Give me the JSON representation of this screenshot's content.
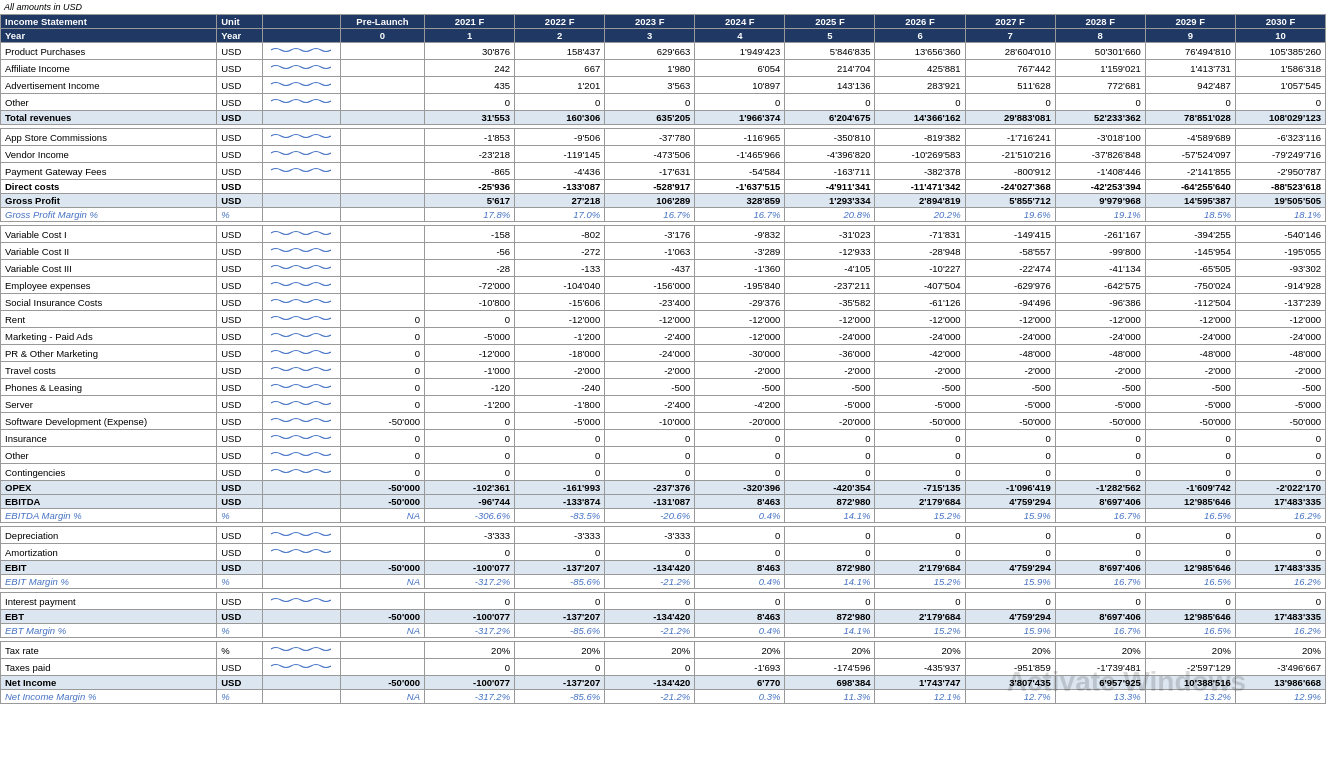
{
  "note": "All amounts in USD",
  "headers": {
    "col0": "Income Statement",
    "col1": "Unit",
    "col2": "",
    "col3": "Pre-Launch",
    "col4": "2021 F",
    "col5": "2022 F",
    "col6": "2023 F",
    "col7": "2024 F",
    "col8": "2025 F",
    "col9": "2026 F",
    "col10": "2027 F",
    "col11": "2028 F",
    "col12": "2029 F",
    "col13": "2030 F",
    "row_year": "Year",
    "year_unit": "Year",
    "years": [
      "0",
      "1",
      "2",
      "3",
      "4",
      "5",
      "6",
      "7",
      "8",
      "9",
      "10"
    ]
  },
  "rows": [
    {
      "label": "Product Purchases",
      "unit": "USD",
      "spark": true,
      "pre": "",
      "y1": "30'876",
      "y2": "158'437",
      "y3": "629'663",
      "y4": "1'949'423",
      "y5": "5'846'835",
      "y6": "13'656'360",
      "y7": "28'604'010",
      "y8": "50'301'660",
      "y9": "76'494'810",
      "y10": "105'385'260"
    },
    {
      "label": "Affiliate Income",
      "unit": "USD",
      "spark": true,
      "pre": "",
      "y1": "242",
      "y2": "667",
      "y3": "1'980",
      "y4": "6'054",
      "y5": "214'704",
      "y6": "425'881",
      "y7": "767'442",
      "y8": "1'159'021",
      "y9": "1'413'731",
      "y10": "1'586'318"
    },
    {
      "label": "Advertisement Income",
      "unit": "USD",
      "spark": true,
      "pre": "",
      "y1": "435",
      "y2": "1'201",
      "y3": "3'563",
      "y4": "10'897",
      "y5": "143'136",
      "y6": "283'921",
      "y7": "511'628",
      "y8": "772'681",
      "y9": "942'487",
      "y10": "1'057'545"
    },
    {
      "label": "Other",
      "unit": "USD",
      "spark": true,
      "pre": "",
      "y1": "0",
      "y2": "0",
      "y3": "0",
      "y4": "0",
      "y5": "0",
      "y6": "0",
      "y7": "0",
      "y8": "0",
      "y9": "0",
      "y10": "0"
    },
    {
      "label": "Total revenues",
      "unit": "USD",
      "spark": false,
      "pre": "",
      "y1": "31'553",
      "y2": "160'306",
      "y3": "635'205",
      "y4": "1'966'374",
      "y5": "6'204'675",
      "y6": "14'366'162",
      "y7": "29'883'081",
      "y8": "52'233'362",
      "y9": "78'851'028",
      "y10": "108'029'123",
      "type": "total"
    },
    {
      "label": "",
      "unit": "",
      "spark": false,
      "pre": "",
      "y1": "",
      "y2": "",
      "y3": "",
      "y4": "",
      "y5": "",
      "y6": "",
      "y7": "",
      "y8": "",
      "y9": "",
      "y10": "",
      "type": "spacer"
    },
    {
      "label": "App Store Commissions",
      "unit": "USD",
      "spark": true,
      "pre": "",
      "y1": "-1'853",
      "y2": "-9'506",
      "y3": "-37'780",
      "y4": "-116'965",
      "y5": "-350'810",
      "y6": "-819'382",
      "y7": "-1'716'241",
      "y8": "-3'018'100",
      "y9": "-4'589'689",
      "y10": "-6'323'116"
    },
    {
      "label": "Vendor Income",
      "unit": "USD",
      "spark": true,
      "pre": "",
      "y1": "-23'218",
      "y2": "-119'145",
      "y3": "-473'506",
      "y4": "-1'465'966",
      "y5": "-4'396'820",
      "y6": "-10'269'583",
      "y7": "-21'510'216",
      "y8": "-37'826'848",
      "y9": "-57'524'097",
      "y10": "-79'249'716"
    },
    {
      "label": "Payment Gateway Fees",
      "unit": "USD",
      "spark": true,
      "pre": "",
      "y1": "-865",
      "y2": "-4'436",
      "y3": "-17'631",
      "y4": "-54'584",
      "y5": "-163'711",
      "y6": "-382'378",
      "y7": "-800'912",
      "y8": "-1'408'446",
      "y9": "-2'141'855",
      "y10": "-2'950'787"
    },
    {
      "label": "Direct costs",
      "unit": "USD",
      "spark": false,
      "pre": "",
      "y1": "-25'936",
      "y2": "-133'087",
      "y3": "-528'917",
      "y4": "-1'637'515",
      "y5": "-4'911'341",
      "y6": "-11'471'342",
      "y7": "-24'027'368",
      "y8": "-42'253'394",
      "y9": "-64'255'640",
      "y10": "-88'523'618",
      "type": "direct"
    },
    {
      "label": "Gross Profit",
      "unit": "USD",
      "spark": false,
      "pre": "",
      "y1": "5'617",
      "y2": "27'218",
      "y3": "106'289",
      "y4": "328'859",
      "y5": "1'293'334",
      "y6": "2'894'819",
      "y7": "5'855'712",
      "y8": "9'979'968",
      "y9": "14'595'387",
      "y10": "19'505'505",
      "type": "gross-profit"
    },
    {
      "label": "Gross Profit Margin %",
      "unit": "%",
      "spark": false,
      "pre": "",
      "y1": "17.8%",
      "y2": "17.0%",
      "y3": "16.7%",
      "y4": "16.7%",
      "y5": "20.8%",
      "y6": "20.2%",
      "y7": "19.6%",
      "y8": "19.1%",
      "y9": "18.5%",
      "y10": "18.1%",
      "type": "margin"
    },
    {
      "label": "",
      "unit": "",
      "spark": false,
      "pre": "",
      "y1": "",
      "y2": "",
      "y3": "",
      "y4": "",
      "y5": "",
      "y6": "",
      "y7": "",
      "y8": "",
      "y9": "",
      "y10": "",
      "type": "spacer"
    },
    {
      "label": "Variable Cost I",
      "unit": "USD",
      "spark": true,
      "pre": "",
      "y1": "-158",
      "y2": "-802",
      "y3": "-3'176",
      "y4": "-9'832",
      "y5": "-31'023",
      "y6": "-71'831",
      "y7": "-149'415",
      "y8": "-261'167",
      "y9": "-394'255",
      "y10": "-540'146"
    },
    {
      "label": "Variable Cost II",
      "unit": "USD",
      "spark": true,
      "pre": "",
      "y1": "-56",
      "y2": "-272",
      "y3": "-1'063",
      "y4": "-3'289",
      "y5": "-12'933",
      "y6": "-28'948",
      "y7": "-58'557",
      "y8": "-99'800",
      "y9": "-145'954",
      "y10": "-195'055"
    },
    {
      "label": "Variable Cost III",
      "unit": "USD",
      "spark": true,
      "pre": "",
      "y1": "-28",
      "y2": "-133",
      "y3": "-437",
      "y4": "-1'360",
      "y5": "-4'105",
      "y6": "-10'227",
      "y7": "-22'474",
      "y8": "-41'134",
      "y9": "-65'505",
      "y10": "-93'302"
    },
    {
      "label": "Employee expenses",
      "unit": "USD",
      "spark": true,
      "pre": "",
      "y1": "-72'000",
      "y2": "-104'040",
      "y3": "-156'000",
      "y4": "-195'840",
      "y5": "-237'211",
      "y6": "-407'504",
      "y7": "-629'976",
      "y8": "-642'575",
      "y9": "-750'024",
      "y10": "-914'928"
    },
    {
      "label": "Social Insurance Costs",
      "unit": "USD",
      "spark": true,
      "pre": "",
      "y1": "-10'800",
      "y2": "-15'606",
      "y3": "-23'400",
      "y4": "-29'376",
      "y5": "-35'582",
      "y6": "-61'126",
      "y7": "-94'496",
      "y8": "-96'386",
      "y9": "-112'504",
      "y10": "-137'239"
    },
    {
      "label": "Rent",
      "unit": "USD",
      "spark": true,
      "pre": "0",
      "y1": "0",
      "y2": "-12'000",
      "y3": "-12'000",
      "y4": "-12'000",
      "y5": "-12'000",
      "y6": "-12'000",
      "y7": "-12'000",
      "y8": "-12'000",
      "y9": "-12'000",
      "y10": "-12'000"
    },
    {
      "label": "Marketing - Paid Ads",
      "unit": "USD",
      "spark": true,
      "pre": "0",
      "y1": "-5'000",
      "y2": "-1'200",
      "y3": "-2'400",
      "y4": "-12'000",
      "y5": "-24'000",
      "y6": "-24'000",
      "y7": "-24'000",
      "y8": "-24'000",
      "y9": "-24'000",
      "y10": "-24'000"
    },
    {
      "label": "PR & Other Marketing",
      "unit": "USD",
      "spark": true,
      "pre": "0",
      "y1": "-12'000",
      "y2": "-18'000",
      "y3": "-24'000",
      "y4": "-30'000",
      "y5": "-36'000",
      "y6": "-42'000",
      "y7": "-48'000",
      "y8": "-48'000",
      "y9": "-48'000",
      "y10": "-48'000"
    },
    {
      "label": "Travel costs",
      "unit": "USD",
      "spark": true,
      "pre": "0",
      "y1": "-1'000",
      "y2": "-2'000",
      "y3": "-2'000",
      "y4": "-2'000",
      "y5": "-2'000",
      "y6": "-2'000",
      "y7": "-2'000",
      "y8": "-2'000",
      "y9": "-2'000",
      "y10": "-2'000"
    },
    {
      "label": "Phones & Leasing",
      "unit": "USD",
      "spark": true,
      "pre": "0",
      "y1": "-120",
      "y2": "-240",
      "y3": "-500",
      "y4": "-500",
      "y5": "-500",
      "y6": "-500",
      "y7": "-500",
      "y8": "-500",
      "y9": "-500",
      "y10": "-500"
    },
    {
      "label": "Server",
      "unit": "USD",
      "spark": true,
      "pre": "0",
      "y1": "-1'200",
      "y2": "-1'800",
      "y3": "-2'400",
      "y4": "-4'200",
      "y5": "-5'000",
      "y6": "-5'000",
      "y7": "-5'000",
      "y8": "-5'000",
      "y9": "-5'000",
      "y10": "-5'000"
    },
    {
      "label": "Software Development (Expense)",
      "unit": "USD",
      "spark": true,
      "pre": "-50'000",
      "y1": "0",
      "y2": "-5'000",
      "y3": "-10'000",
      "y4": "-20'000",
      "y5": "-20'000",
      "y6": "-50'000",
      "y7": "-50'000",
      "y8": "-50'000",
      "y9": "-50'000",
      "y10": "-50'000"
    },
    {
      "label": "Insurance",
      "unit": "USD",
      "spark": true,
      "pre": "0",
      "y1": "0",
      "y2": "0",
      "y3": "0",
      "y4": "0",
      "y5": "0",
      "y6": "0",
      "y7": "0",
      "y8": "0",
      "y9": "0",
      "y10": "0"
    },
    {
      "label": "Other",
      "unit": "USD",
      "spark": true,
      "pre": "0",
      "y1": "0",
      "y2": "0",
      "y3": "0",
      "y4": "0",
      "y5": "0",
      "y6": "0",
      "y7": "0",
      "y8": "0",
      "y9": "0",
      "y10": "0"
    },
    {
      "label": "Contingencies",
      "unit": "USD",
      "spark": true,
      "pre": "0",
      "y1": "0",
      "y2": "0",
      "y3": "0",
      "y4": "0",
      "y5": "0",
      "y6": "0",
      "y7": "0",
      "y8": "0",
      "y9": "0",
      "y10": "0"
    },
    {
      "label": "OPEX",
      "unit": "USD",
      "spark": false,
      "pre": "-50'000",
      "y1": "-102'361",
      "y2": "-161'993",
      "y3": "-237'376",
      "y4": "-320'396",
      "y5": "-420'354",
      "y6": "-715'135",
      "y7": "-1'096'419",
      "y8": "-1'282'562",
      "y9": "-1'609'742",
      "y10": "-2'022'170",
      "type": "opex"
    },
    {
      "label": "EBITDA",
      "unit": "USD",
      "spark": false,
      "pre": "-50'000",
      "y1": "-96'744",
      "y2": "-133'874",
      "y3": "-131'087",
      "y4": "8'463",
      "y5": "872'980",
      "y6": "2'179'684",
      "y7": "4'759'294",
      "y8": "8'697'406",
      "y9": "12'985'646",
      "y10": "17'483'335",
      "type": "ebitda"
    },
    {
      "label": "EBITDA Margin %",
      "unit": "%",
      "spark": false,
      "pre": "",
      "y1": "-306.6%",
      "y2": "-83.5%",
      "y3": "-20.6%",
      "y4": "0.4%",
      "y5": "14.1%",
      "y6": "15.2%",
      "y7": "15.9%",
      "y8": "16.7%",
      "y9": "16.5%",
      "y10": "16.2%",
      "pre_special": "NA",
      "type": "margin"
    },
    {
      "label": "",
      "unit": "",
      "spark": false,
      "pre": "",
      "y1": "",
      "y2": "",
      "y3": "",
      "y4": "",
      "y5": "",
      "y6": "",
      "y7": "",
      "y8": "",
      "y9": "",
      "y10": "",
      "type": "spacer"
    },
    {
      "label": "Depreciation",
      "unit": "USD",
      "spark": true,
      "pre": "",
      "y1": "-3'333",
      "y2": "-3'333",
      "y3": "-3'333",
      "y4": "0",
      "y5": "0",
      "y6": "0",
      "y7": "0",
      "y8": "0",
      "y9": "0",
      "y10": "0"
    },
    {
      "label": "Amortization",
      "unit": "USD",
      "spark": true,
      "pre": "",
      "y1": "0",
      "y2": "0",
      "y3": "0",
      "y4": "0",
      "y5": "0",
      "y6": "0",
      "y7": "0",
      "y8": "0",
      "y9": "0",
      "y10": "0"
    },
    {
      "label": "EBIT",
      "unit": "USD",
      "spark": false,
      "pre": "-50'000",
      "y1": "-100'077",
      "y2": "-137'207",
      "y3": "-134'420",
      "y4": "8'463",
      "y5": "872'980",
      "y6": "2'179'684",
      "y7": "4'759'294",
      "y8": "8'697'406",
      "y9": "12'985'646",
      "y10": "17'483'335",
      "type": "ebit"
    },
    {
      "label": "EBIT Margin %",
      "unit": "%",
      "spark": false,
      "pre": "",
      "y1": "-317.2%",
      "y2": "-85.6%",
      "y3": "-21.2%",
      "y4": "0.4%",
      "y5": "14.1%",
      "y6": "15.2%",
      "y7": "15.9%",
      "y8": "16.7%",
      "y9": "16.5%",
      "y10": "16.2%",
      "pre_special": "NA",
      "type": "margin"
    },
    {
      "label": "",
      "unit": "",
      "spark": false,
      "pre": "",
      "y1": "",
      "y2": "",
      "y3": "",
      "y4": "",
      "y5": "",
      "y6": "",
      "y7": "",
      "y8": "",
      "y9": "",
      "y10": "",
      "type": "spacer"
    },
    {
      "label": "Interest payment",
      "unit": "USD",
      "spark": true,
      "pre": "",
      "y1": "0",
      "y2": "0",
      "y3": "0",
      "y4": "0",
      "y5": "0",
      "y6": "0",
      "y7": "0",
      "y8": "0",
      "y9": "0",
      "y10": "0"
    },
    {
      "label": "EBT",
      "unit": "USD",
      "spark": false,
      "pre": "-50'000",
      "y1": "-100'077",
      "y2": "-137'207",
      "y3": "-134'420",
      "y4": "8'463",
      "y5": "872'980",
      "y6": "2'179'684",
      "y7": "4'759'294",
      "y8": "8'697'406",
      "y9": "12'985'646",
      "y10": "17'483'335",
      "type": "ebt"
    },
    {
      "label": "EBT Margin %",
      "unit": "%",
      "spark": false,
      "pre": "",
      "y1": "-317.2%",
      "y2": "-85.6%",
      "y3": "-21.2%",
      "y4": "0.4%",
      "y5": "14.1%",
      "y6": "15.2%",
      "y7": "15.9%",
      "y8": "16.7%",
      "y9": "16.5%",
      "y10": "16.2%",
      "pre_special": "NA",
      "type": "margin"
    },
    {
      "label": "",
      "unit": "",
      "spark": false,
      "pre": "",
      "y1": "",
      "y2": "",
      "y3": "",
      "y4": "",
      "y5": "",
      "y6": "",
      "y7": "",
      "y8": "",
      "y9": "",
      "y10": "",
      "type": "spacer"
    },
    {
      "label": "Tax rate",
      "unit": "%",
      "spark": true,
      "pre": "",
      "y1": "20%",
      "y2": "20%",
      "y3": "20%",
      "y4": "20%",
      "y5": "20%",
      "y6": "20%",
      "y7": "20%",
      "y8": "20%",
      "y9": "20%",
      "y10": "20%",
      "type": "tax"
    },
    {
      "label": "Taxes paid",
      "unit": "USD",
      "spark": true,
      "pre": "",
      "y1": "0",
      "y2": "0",
      "y3": "0",
      "y4": "-1'693",
      "y5": "-174'596",
      "y6": "-435'937",
      "y7": "-951'859",
      "y8": "-1'739'481",
      "y9": "-2'597'129",
      "y10": "-3'496'667"
    },
    {
      "label": "Net Income",
      "unit": "USD",
      "spark": false,
      "pre": "-50'000",
      "y1": "-100'077",
      "y2": "-137'207",
      "y3": "-134'420",
      "y4": "6'770",
      "y5": "698'384",
      "y6": "1'743'747",
      "y7": "3'807'435",
      "y8": "6'957'925",
      "y9": "10'388'516",
      "y10": "13'986'668",
      "type": "net-income"
    },
    {
      "label": "Net Income Margin %",
      "unit": "%",
      "spark": false,
      "pre": "",
      "y1": "-317.2%",
      "y2": "-85.6%",
      "y3": "-21.2%",
      "y4": "0.3%",
      "y5": "11.3%",
      "y6": "12.1%",
      "y7": "12.7%",
      "y8": "13.3%",
      "y9": "13.2%",
      "y10": "12.9%",
      "pre_special": "NA",
      "type": "margin"
    }
  ],
  "watermark": "Activate Windows"
}
